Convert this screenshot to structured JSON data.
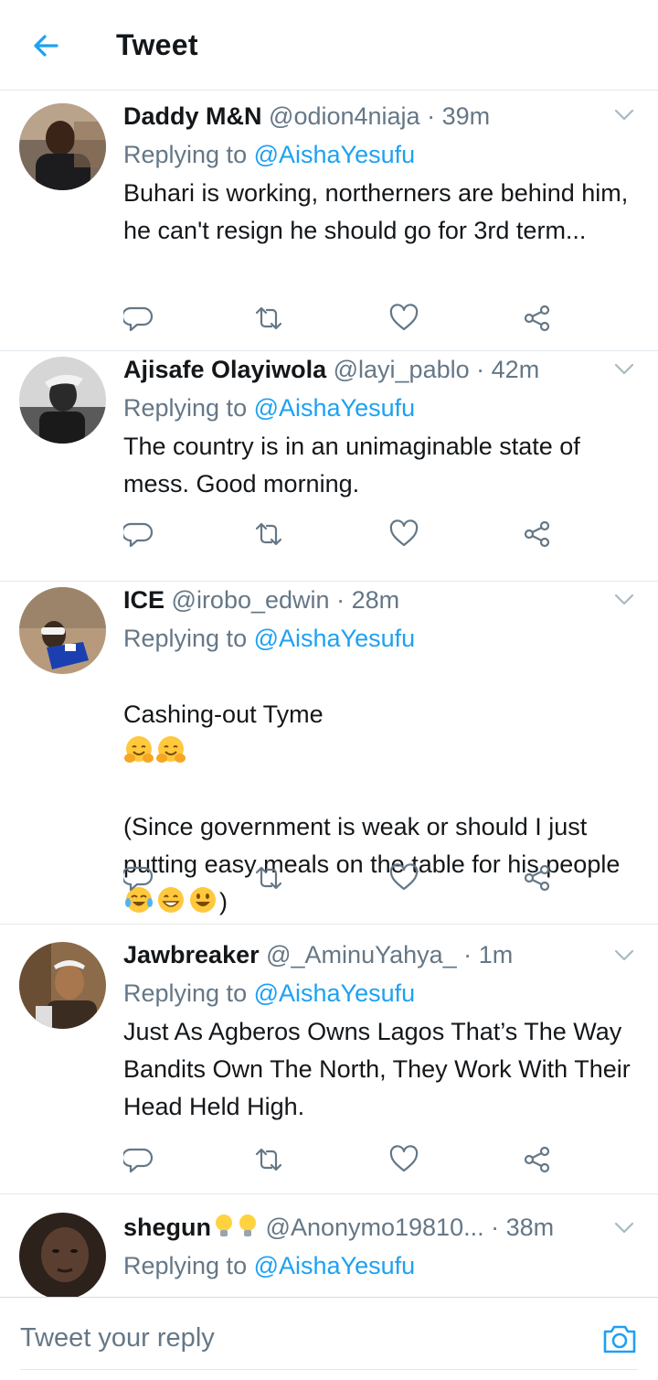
{
  "header": {
    "title": "Tweet",
    "back_icon": "back-arrow-icon"
  },
  "colors": {
    "accent": "#1da1f2",
    "muted": "#657786",
    "text": "#14171a",
    "divider": "#e1e8ed"
  },
  "tweets": [
    {
      "name": "Daddy M&N",
      "handle": "@odion4niaja",
      "dot": "·",
      "time": "39m",
      "reply_prefix": "Replying to",
      "reply_to": "@AishaYesufu",
      "text": "Buhari is working, northerners are behind him, he can't resign he should go for 3rd term..."
    },
    {
      "name": "Ajisafe Olayiwola",
      "handle": "@layi_pablo",
      "dot": "·",
      "time": "42m",
      "reply_prefix": "Replying to",
      "reply_to": "@AishaYesufu",
      "text": "The country is in an unimaginable state of mess. Good morning."
    },
    {
      "name": "ICE",
      "handle": "@irobo_edwin",
      "dot": "·",
      "time": "28m",
      "reply_prefix": "Replying to",
      "reply_to": "@AishaYesufu",
      "text_line1": "Cashing-out Tyme",
      "text_line2": "(Since government is weak or should I just putting easy meals  on the table for his people",
      "text_line2_end": ")"
    },
    {
      "name": "Jawbreaker",
      "handle": "@_AminuYahya_",
      "dot": "·",
      "time": "1m",
      "reply_prefix": "Replying to",
      "reply_to": "@AishaYesufu",
      "text": "Just As Agberos Owns Lagos That’s The Way Bandits Own The North, They Work With Their Head Held High."
    },
    {
      "name": "shegun",
      "handle": "@Anonymo19810...",
      "dot": "·",
      "time": "38m",
      "reply_prefix": "Replying to",
      "reply_to": "@AishaYesufu"
    }
  ],
  "composer": {
    "placeholder": "Tweet your reply",
    "camera_icon": "camera-icon"
  }
}
